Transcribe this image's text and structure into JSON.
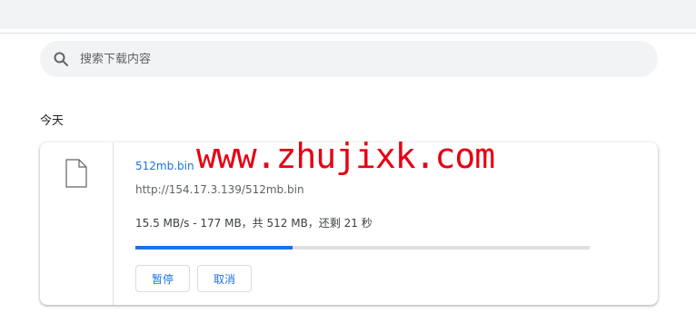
{
  "search": {
    "placeholder": "搜索下载内容",
    "icon": "search-icon"
  },
  "date_header": "今天",
  "download": {
    "filename": "512mb.bin",
    "url": "http://154.17.3.139/512mb.bin",
    "status": "15.5 MB/s - 177 MB，共 512 MB，还剩 21 秒",
    "progress_fraction": 0.3457,
    "pause_label": "暂停",
    "cancel_label": "取消",
    "icon": "file-icon"
  },
  "watermark": "www.zhujixk.com",
  "colors": {
    "accent": "#1a73e8",
    "watermark": "#e60012"
  }
}
